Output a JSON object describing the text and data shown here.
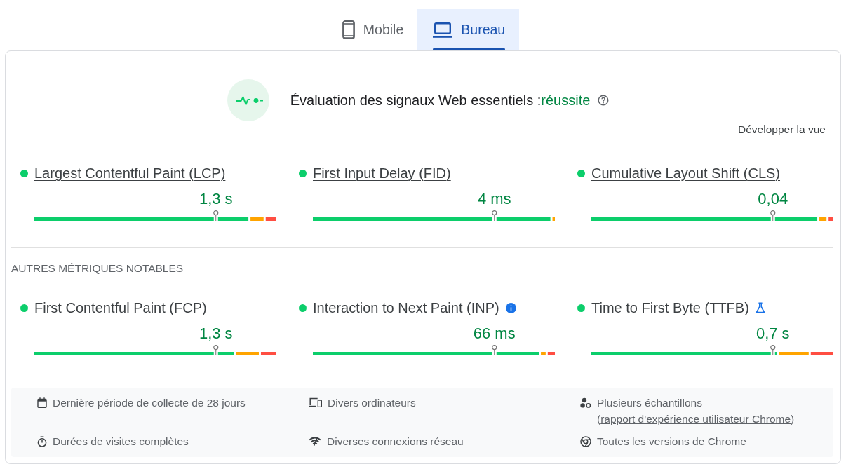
{
  "tabs": [
    {
      "label": "Mobile",
      "selected": false
    },
    {
      "label": "Bureau",
      "selected": true
    }
  ],
  "assessment": {
    "title": "Évaluation des signaux Web essentiels :",
    "result": "réussite",
    "passed": true
  },
  "expand_link": "Développer la vue",
  "core_metrics": [
    {
      "name": "Largest Contentful Paint (LCP)",
      "passed": true,
      "value": "1,3 s",
      "marker": {
        "level": 0.75
      }
    },
    {
      "name": "First Input Delay (FID)",
      "passed": true,
      "value": "4 ms",
      "marker": {
        "level": 0.75
      }
    },
    {
      "name": "Cumulative Layout Shift (CLS)",
      "passed": true,
      "value": "0,04",
      "marker": {
        "level": 0.75
      }
    }
  ],
  "other_metrics": {
    "heading": "AUTRES MÉTRIQUES NOTABLES",
    "metrics": [
      {
        "name": "First Contentful Paint (FCP)",
        "passed": true,
        "info_note": false,
        "experimental": false,
        "value": "1,3 s",
        "marker": {
          "level": 0.75
        }
      },
      {
        "name": "Interaction to Next Paint (INP)",
        "passed": true,
        "info_note": true,
        "experimental": false,
        "value": "66 ms",
        "marker": {
          "level": 0.75
        }
      },
      {
        "name": "Time to First Byte (TTFB)",
        "passed": true,
        "info_note": false,
        "experimental": true,
        "value": "0,7 s",
        "marker": {
          "level": 0.75
        }
      }
    ]
  },
  "details": [
    {
      "text": "Dernière période de collecte de 28 jours"
    },
    {
      "text": "Divers ordinateurs"
    },
    {
      "text": "Plusieurs échantillons (",
      "link": "rapport d'expérience utilisateur Chrome",
      "suffix": ")"
    },
    {
      "text": "Durées de visites complètes"
    },
    {
      "text": "Diverses connexions réseau"
    },
    {
      "text": "Toutes les versions de Chrome"
    }
  ]
}
